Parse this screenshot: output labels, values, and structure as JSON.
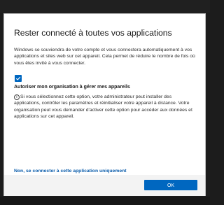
{
  "dialog": {
    "title": "Rester connecté à toutes vos applications",
    "description": "Windows se souviendra de votre compte et vous connectera automatiquement à vos applications et sites web sur cet appareil. Cela permet de réduire le nombre de fois où vous êtes invité à vous connecter.",
    "checkbox": {
      "checked": true,
      "label": "Autoriser mon organisation à gérer mes appareils"
    },
    "info": {
      "icon": "info-icon",
      "text": "Si vous sélectionnez cette option, votre administrateur peut installer des applications, contrôler les paramètres et réinitialiser votre appareil à distance. Votre organisation peut vous demander d'activer cette option pour accéder aux données et applications sur cet appareil."
    },
    "link_text": "Non, se connecter à cette application uniquement",
    "ok_label": "OK"
  },
  "colors": {
    "accent": "#0067c0",
    "link": "#0a5cab",
    "backdrop": "#1c1c1c"
  }
}
